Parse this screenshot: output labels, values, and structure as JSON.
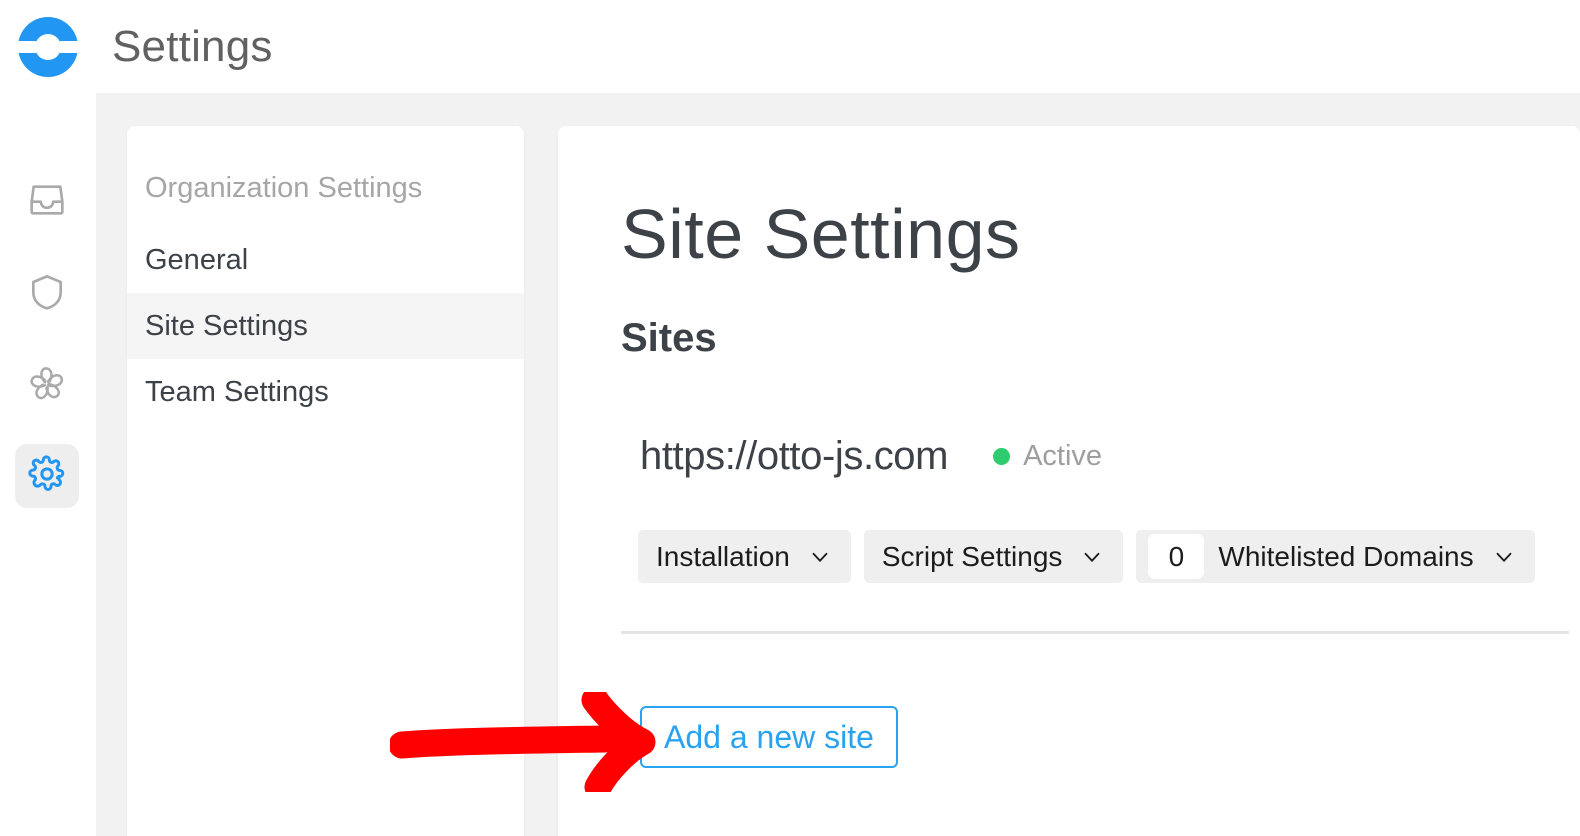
{
  "header": {
    "title": "Settings",
    "logo_icon": "otto-ring-logo",
    "logo_color": "#2196f3"
  },
  "rail": {
    "items": [
      {
        "icon": "inbox-icon",
        "name": "inbox",
        "active": false
      },
      {
        "icon": "shield-icon",
        "name": "shield",
        "active": false
      },
      {
        "icon": "pinwheel-icon",
        "name": "pinwheel",
        "active": false
      },
      {
        "icon": "gear-icon",
        "name": "settings",
        "active": true
      }
    ],
    "active_color": "#2196f3",
    "inactive_color": "#aaaaaa",
    "active_bg": "#eeeeee"
  },
  "nav": {
    "section_label": "Organization Settings",
    "items": [
      {
        "label": "General",
        "active": false
      },
      {
        "label": "Site Settings",
        "active": true
      },
      {
        "label": "Team Settings",
        "active": false
      }
    ]
  },
  "main": {
    "title": "Site Settings",
    "subtitle": "Sites",
    "site": {
      "url": "https://otto-js.com",
      "status_label": "Active",
      "status_color": "#2ecc6f"
    },
    "pills": [
      {
        "label": "Installation",
        "badge": null,
        "chevron": "chevron-down-icon"
      },
      {
        "label": "Script Settings",
        "badge": null,
        "chevron": "chevron-down-icon"
      },
      {
        "label": "Whitelisted Domains",
        "badge": "0",
        "chevron": "chevron-down-icon"
      }
    ],
    "add_site_label": "Add a new site",
    "add_site_color": "#29a3f0"
  },
  "annotation": {
    "arrow_color": "#ff0000",
    "arrow_direction": "right",
    "points_at": "Add a new site"
  }
}
